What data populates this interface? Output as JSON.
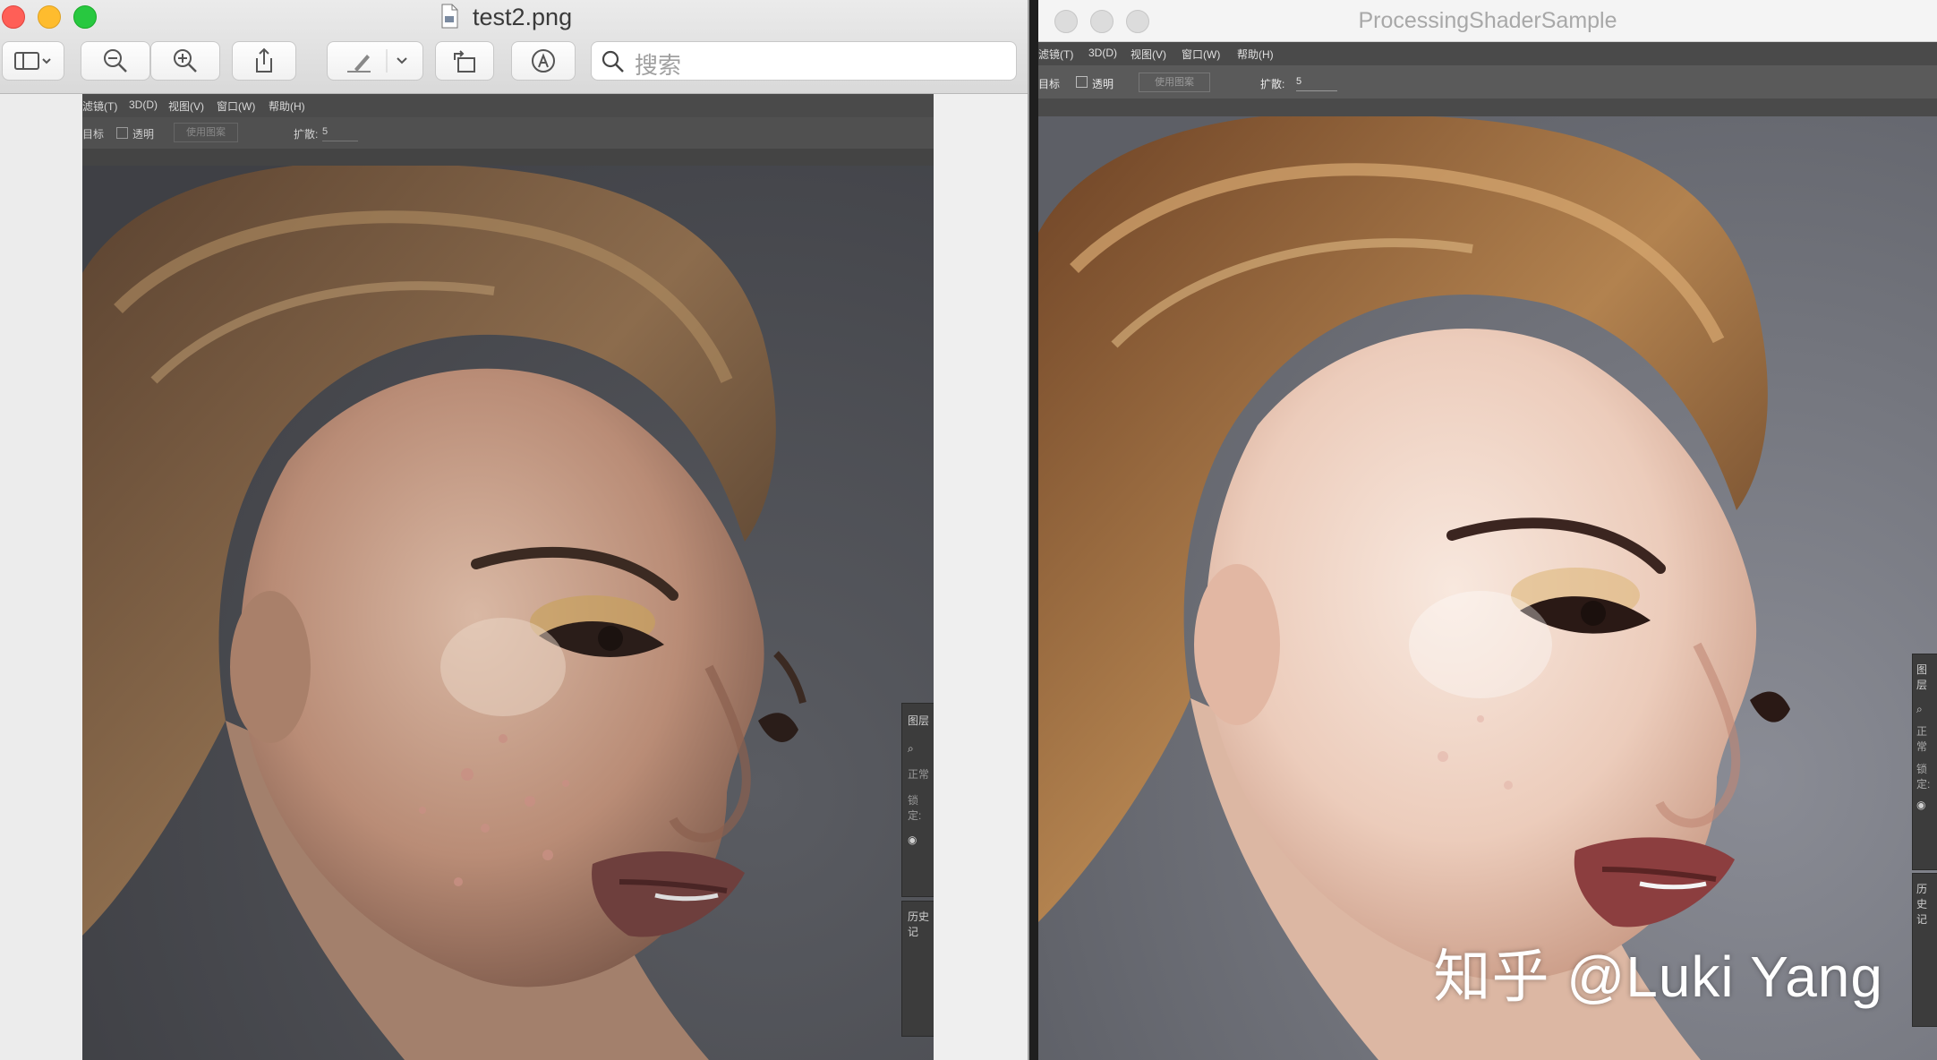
{
  "left_window": {
    "title": "test2.png",
    "search_placeholder": "搜索",
    "ps_menu": [
      "滤镜(T)",
      "3D(D)",
      "视图(V)",
      "窗口(W)",
      "帮助(H)"
    ],
    "ps_options": {
      "target_label": "目标",
      "transparent_label": "透明",
      "use_pattern_label": "使用图案",
      "spread_label": "扩散:",
      "spread_value": "5"
    },
    "layers_panel": {
      "title": "图层",
      "mode": "正常",
      "lock": "锁定:"
    },
    "history_panel": {
      "title": "历史记"
    }
  },
  "right_window": {
    "title": "ProcessingShaderSample",
    "ps_menu": [
      "滤镜(T)",
      "3D(D)",
      "视图(V)",
      "窗口(W)",
      "帮助(H)"
    ],
    "ps_options": {
      "target_label": "目标",
      "transparent_label": "透明",
      "use_pattern_label": "使用图案",
      "spread_label": "扩散:",
      "spread_value": "5"
    },
    "layers_panel": {
      "title": "图层",
      "mode": "正常",
      "lock": "锁定:"
    },
    "history_panel": {
      "title": "历史记"
    },
    "watermark": "知乎 @Luki Yang"
  },
  "colors": {
    "close": "#ff5f57",
    "minimize": "#febc2e",
    "zoom": "#28c840",
    "ps_dark": "#4a4a4a"
  }
}
